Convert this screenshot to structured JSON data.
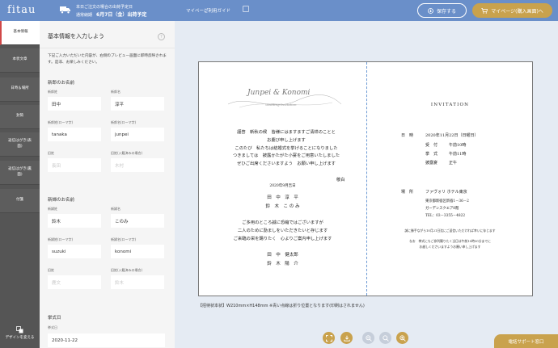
{
  "header": {
    "logo": "fitau",
    "ship_line1": "本日ご注文の場合の出荷予定日",
    "ship_label": "通常納期",
    "ship_date": "6月7日（金）出荷予定",
    "nav_mypage": "マイページ",
    "nav_guide": "ご利用ガイド",
    "save_button": "保存する",
    "mypage_button": "マイページ(購入画面)へ"
  },
  "sidebar": {
    "items": [
      {
        "label": "基本情報"
      },
      {
        "label": "本状文章"
      },
      {
        "label": "日時＆場所"
      },
      {
        "label": "封筒"
      },
      {
        "label": "返信はがき(表面)"
      },
      {
        "label": "返信はがき(裏面)"
      },
      {
        "label": "付箋"
      }
    ],
    "design_button": "デザインを変える"
  },
  "form": {
    "title": "基本情報を入力しよう",
    "help": "?",
    "description": "下記ご入力いただいた内容が、右側のプレビュー画面に即時反映されます。是非、お楽しみください。",
    "groom": {
      "section": "新郎のお名前",
      "last_label": "新郎姓",
      "last_value": "田中",
      "first_label": "新郎名",
      "first_value": "淳平",
      "last_roman_label": "新郎姓(ローマ字)",
      "last_roman_value": "tanaka",
      "first_roman_label": "新郎名(ローマ字)",
      "first_roman_value": "junpei",
      "old_label": "旧姓",
      "old_placeholder": "長田",
      "old_rel_label": "旧姓(入籍済みの場合)",
      "old_rel_placeholder": "木村"
    },
    "bride": {
      "section": "新婦のお名前",
      "last_label": "新婦姓",
      "last_value": "鈴木",
      "first_label": "新婦名",
      "first_value": "このみ",
      "last_roman_label": "新婦姓(ローマ字)",
      "last_roman_value": "suzuki",
      "first_roman_label": "新婦名(ローマ字)",
      "first_roman_value": "konomi",
      "old_label": "旧姓",
      "old_placeholder": "鹿文",
      "old_rel_label": "旧姓(入籍済みの場合)",
      "old_rel_placeholder": "鈴木"
    },
    "ceremony": {
      "section": "挙式日",
      "label": "挙式日",
      "value": "2020-11-22"
    }
  },
  "preview": {
    "script_title": "Junpei & Konomi",
    "script_sub": "Wedding Invitation",
    "greeting": [
      "謹啓　新秋の候　皆様にはますますご清祥のことと",
      "お慶び申し上げます",
      "このたび　私たちは結婚式を挙げることになりました",
      "つきましては　披露かたがた小宴をご用意いたしました",
      "ぜひご出席くださいますよう　お願い申し上げます"
    ],
    "keigu": "敬白",
    "card_date": "2020年9月吉日",
    "names": [
      "田　中　淳　平",
      "鈴　木　こ の み"
    ],
    "message": [
      "ご多用のところ誠に恐縮ではございますが",
      "二人のために励ましをいただきたいと存じます",
      "ご来臨の栄を賜りたく　心よりご案内申し上げます"
    ],
    "names2": [
      "田　中　健太郎",
      "鈴　木　陽　介"
    ],
    "inv_title": "INVITATION",
    "date_label": "日　時",
    "date_value": "2020年11月22日（日曜日）",
    "t1_label": "受　付",
    "t1_value": "午前10時",
    "t2_label": "挙　式",
    "t2_value": "午前11時",
    "t3_label": "披露宴",
    "t3_value": "正午",
    "place_label": "場　所",
    "place_name": "ファヴォリ ホテル東京",
    "address1": "東京都新宿区新宿1－36－2",
    "address2": "ガーデンスクエア8階",
    "tel": "TEL：03－3355－4822",
    "note1": "誠に勝手ながら10月21日迄にご返信いただければ幸いに存じます",
    "note2": "なお　挙式にもご参列賜りたく当日は午前10時30分までに",
    "note3": "お越しくださいますようお願い申し上げます"
  },
  "caption": "【招待状本状】W210mm×H148mm ※青い点線は折り位置となります(印刷はされません)",
  "support_button": "電話サポート窓口"
}
